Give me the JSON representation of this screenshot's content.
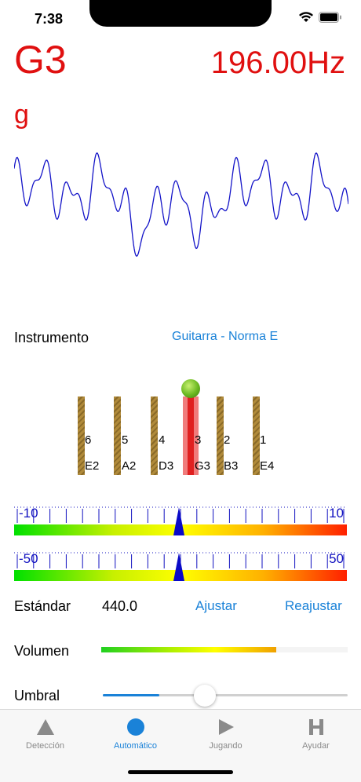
{
  "status": {
    "time": "7:38"
  },
  "tuner": {
    "note": "G3",
    "frequency": "196.00",
    "frequency_unit": "Hz",
    "note_letter": "g"
  },
  "instrument": {
    "label": "Instrumento",
    "value": "Guitarra - Norma E"
  },
  "strings": [
    {
      "number": "6",
      "name": "E2",
      "active": false
    },
    {
      "number": "5",
      "name": "A2",
      "active": false
    },
    {
      "number": "4",
      "name": "D3",
      "active": false
    },
    {
      "number": "3",
      "name": "G3",
      "active": true
    },
    {
      "number": "2",
      "name": "B3",
      "active": false
    },
    {
      "number": "1",
      "name": "E4",
      "active": false
    }
  ],
  "meters": [
    {
      "min_label": "-10",
      "max_label": "10",
      "value": 0
    },
    {
      "min_label": "-50",
      "max_label": "50",
      "value": 0
    }
  ],
  "standard": {
    "label": "Estándar",
    "value": "440.0",
    "adjust": "Ajustar",
    "readjust": "Reajustar"
  },
  "volume": {
    "label": "Volumen",
    "level": 0.71
  },
  "threshold": {
    "label": "Umbral",
    "level": 0.23
  },
  "colors": {
    "accent": "#1a82d8",
    "note": "#e01010",
    "wave": "#1414c8",
    "meter_label": "#1010c0"
  },
  "tabs": [
    {
      "label": "Detección",
      "icon": "triangle-icon",
      "active": false
    },
    {
      "label": "Automático",
      "icon": "circle-icon",
      "active": true
    },
    {
      "label": "Jugando",
      "icon": "play-icon",
      "active": false
    },
    {
      "label": "Ayudar",
      "icon": "h-icon",
      "active": false
    }
  ]
}
